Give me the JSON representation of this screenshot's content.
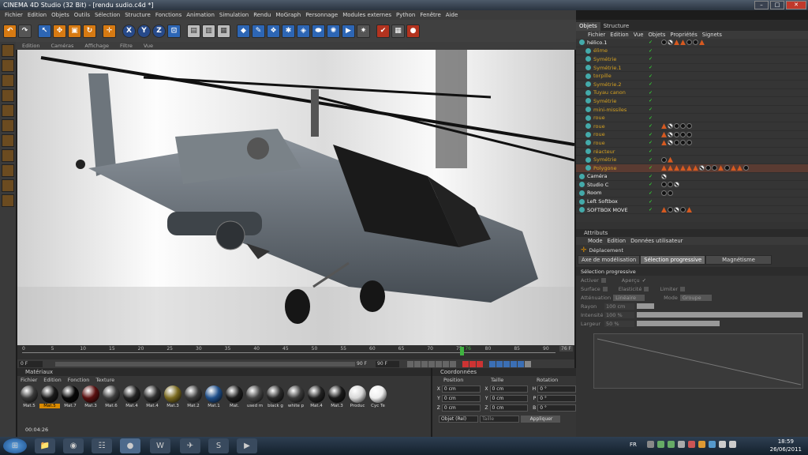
{
  "window": {
    "title": "CINEMA 4D Studio (32 Bit) - [rendu sudio.c4d *]"
  },
  "menubar": [
    "Fichier",
    "Edition",
    "Objets",
    "Outils",
    "Sélection",
    "Structure",
    "Fonctions",
    "Animation",
    "Simulation",
    "Rendu",
    "MoGraph",
    "Personnage",
    "Modules externes",
    "Python",
    "Fenêtre",
    "Aide"
  ],
  "toolbar": {
    "axis_x": "X",
    "axis_y": "Y",
    "axis_z": "Z"
  },
  "viewport": {
    "menu": [
      "Edition",
      "Caméras",
      "Affichage",
      "Filtre",
      "Vue"
    ]
  },
  "timeline": {
    "ticks": [
      "0",
      "5",
      "10",
      "15",
      "20",
      "25",
      "30",
      "35",
      "40",
      "45",
      "50",
      "55",
      "60",
      "65",
      "70",
      "75",
      "80",
      "85",
      "90"
    ],
    "current_frame": "76",
    "end_field": "76 F",
    "start_field": "0 F",
    "range_end": "90 F",
    "max_field": "90 F",
    "cursor_field": "0 F"
  },
  "materials": {
    "title": "Matériaux",
    "menu": [
      "Fichier",
      "Edition",
      "Fonction",
      "Texture"
    ],
    "items": [
      {
        "label": "Mat.5",
        "color": "#3a3a3a"
      },
      {
        "label": "Mat.5",
        "color": "#1a1a1a",
        "selected": true
      },
      {
        "label": "Mat.7",
        "color": "#080808"
      },
      {
        "label": "Mat.3",
        "color": "#5a1010"
      },
      {
        "label": "Mat.6",
        "color": "#3c3c3c"
      },
      {
        "label": "Mat.4",
        "color": "#222222"
      },
      {
        "label": "Mat.4",
        "color": "#2e2e2e"
      },
      {
        "label": "Mat.3",
        "color": "#7a6a20"
      },
      {
        "label": "Mat.2",
        "color": "#3a3a3a"
      },
      {
        "label": "Mat.1",
        "color": "#1f4f8a"
      },
      {
        "label": "Mat.",
        "color": "#1e1e1e"
      },
      {
        "label": "used m",
        "color": "#444444"
      },
      {
        "label": "black g",
        "color": "#2a2a2a"
      },
      {
        "label": "white p",
        "color": "#3a3a3a"
      },
      {
        "label": "Mat.4",
        "color": "#222222"
      },
      {
        "label": "Mat.3",
        "color": "#1a1a1a"
      },
      {
        "label": "Produc",
        "color": "#d8d8d8"
      },
      {
        "label": "Cyc Te",
        "color": "#eeeeee"
      }
    ]
  },
  "coordinates": {
    "title": "Coordonnées",
    "headers": [
      "Position",
      "Taille",
      "Rotation"
    ],
    "rows": [
      {
        "axis": "X",
        "pos": "0 cm",
        "size_axis": "X",
        "size": "0 cm",
        "rot_axis": "H",
        "rot": "0 °"
      },
      {
        "axis": "Y",
        "pos": "0 cm",
        "size_axis": "Y",
        "size": "0 cm",
        "rot_axis": "P",
        "rot": "0 °"
      },
      {
        "axis": "Z",
        "pos": "0 cm",
        "size_axis": "Z",
        "size": "0 cm",
        "rot_axis": "B",
        "rot": "0 °"
      }
    ],
    "mode_select": "Objet (Rel)",
    "size_select": "Taille",
    "apply_button": "Appliquer"
  },
  "status": {
    "time": "00:04:26"
  },
  "right": {
    "tabs": [
      "Objets",
      "Structure"
    ],
    "menu": [
      "Fichier",
      "Edition",
      "Vue",
      "Objets",
      "Propriétés",
      "Signets"
    ],
    "objects": [
      {
        "name": "hélico.1",
        "style": "white"
      },
      {
        "name": "élime",
        "style": "gold"
      },
      {
        "name": "Symétrie",
        "style": "gold"
      },
      {
        "name": "Symétrie.1",
        "style": "gold"
      },
      {
        "name": "torpille",
        "style": "gold"
      },
      {
        "name": "Symétrie.2",
        "style": "gold"
      },
      {
        "name": "Tuyau canon",
        "style": "gold"
      },
      {
        "name": "Symétrie",
        "style": "gold"
      },
      {
        "name": "mini-missiles",
        "style": "gold"
      },
      {
        "name": "roue",
        "style": "gold"
      },
      {
        "name": "roue",
        "style": "gold"
      },
      {
        "name": "roue",
        "style": "gold"
      },
      {
        "name": "roue",
        "style": "gold"
      },
      {
        "name": "réacteur",
        "style": "gold"
      },
      {
        "name": "Symétrie",
        "style": "gold"
      },
      {
        "name": "Polygone",
        "style": "gold",
        "selected": true
      },
      {
        "name": "Caméra",
        "style": "white"
      },
      {
        "name": "Studio C",
        "style": "white"
      },
      {
        "name": "Room",
        "style": "white"
      },
      {
        "name": "Left Softbox",
        "style": "white"
      },
      {
        "name": "SOFTBOX MOVE",
        "style": "white"
      }
    ],
    "attributes": {
      "title": "Attributs",
      "menu": [
        "Mode",
        "Edition",
        "Données utilisateur"
      ],
      "tool": "Déplacement",
      "tabs": [
        "Axe de modélisation",
        "Sélection progressive",
        "Magnétisme"
      ],
      "section": "Sélection progressive",
      "activer": "Activer",
      "apercu": "Aperçu",
      "surface": "Surface",
      "elasticite": "Elasticité",
      "limiter": "Limiter",
      "attenuation_label": "Atténuation",
      "attenuation_value": "Linéaire",
      "mode_label": "Mode",
      "mode_value": "Groupe",
      "rayon_label": "Rayon",
      "rayon_value": "100 cm",
      "intensite_label": "Intensité",
      "intensite_value": "100 %",
      "largeur_label": "Largeur",
      "largeur_value": "50 %"
    }
  },
  "taskbar": {
    "lang": "FR",
    "time": "18:59",
    "date": "26/06/2011"
  }
}
